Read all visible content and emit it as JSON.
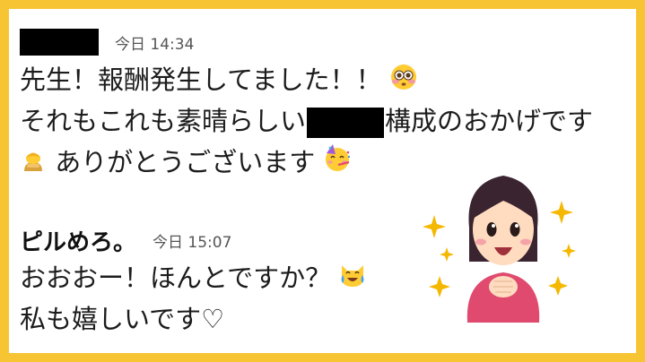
{
  "messages": [
    {
      "timestamp": "今日 14:34",
      "lines": [
        {
          "text": "先生！報酬発生してました！！",
          "emoji": "flushed-face-icon"
        },
        {
          "before": "それもこれも素晴らしい",
          "after": "構成のおかげです"
        },
        {
          "text": "ありがとうございます",
          "emoji_before": "bowing-person-icon",
          "emoji_after": "partying-face-icon"
        }
      ]
    },
    {
      "sender": "ピルめろ。",
      "timestamp": "今日 15:07",
      "lines": [
        {
          "text": "おおおー！ほんとですか？",
          "emoji": "cat-tears-of-joy-icon"
        },
        {
          "text": "私も嬉しいです♡"
        }
      ]
    }
  ],
  "colors": {
    "frame": "#f7c533",
    "redaction": "#000000",
    "text": "#1c1c1c",
    "timestamp": "#555555"
  },
  "illustration": {
    "icon": "happy-woman-illustration-icon"
  }
}
